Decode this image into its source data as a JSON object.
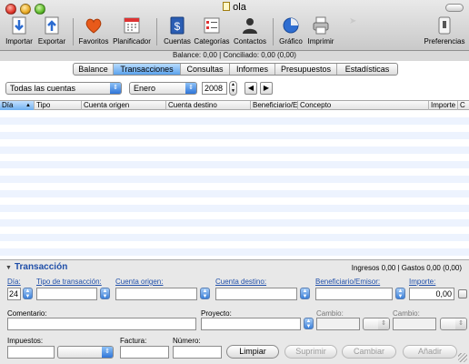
{
  "window": {
    "title": "ola"
  },
  "toolbar": {
    "items": [
      {
        "label": "Importar",
        "icon": "import-icon"
      },
      {
        "label": "Exportar",
        "icon": "export-icon"
      },
      {
        "label": "Favoritos",
        "icon": "heart-icon"
      },
      {
        "label": "Planificador",
        "icon": "calendar-icon"
      },
      {
        "label": "Cuentas",
        "icon": "dollar-ledger-icon"
      },
      {
        "label": "Categorías",
        "icon": "categories-icon"
      },
      {
        "label": "Contactos",
        "icon": "person-icon"
      },
      {
        "label": "Gráfico",
        "icon": "pie-chart-icon"
      },
      {
        "label": "Imprimir",
        "icon": "printer-icon"
      },
      {
        "label": "Preferencias",
        "icon": "preferences-switch-icon"
      }
    ]
  },
  "status": {
    "balance": "Balance: 0,00 | Conciliado: 0,00 (0,00)"
  },
  "tabs": [
    {
      "label": "Balance",
      "active": false
    },
    {
      "label": "Transacciones",
      "active": true
    },
    {
      "label": "Consultas",
      "active": false
    },
    {
      "label": "Informes",
      "active": false
    },
    {
      "label": "Presupuestos",
      "active": false
    },
    {
      "label": "Estadísticas",
      "active": false
    }
  ],
  "filters": {
    "account": "Todas las cuentas",
    "month": "Enero",
    "year": "2008",
    "prev": "◀",
    "next": "▶"
  },
  "table": {
    "columns": [
      "Día",
      "Tipo",
      "Cuenta origen",
      "Cuenta destino",
      "Beneficiario/E...",
      "Concepto",
      "Importe",
      "C"
    ],
    "sorted_column": "Día",
    "rows": []
  },
  "transaction": {
    "title": "Transacción",
    "summary": "Ingresos 0,00 | Gastos 0,00 (0,00)",
    "day_label": "Día:",
    "day_value": "24",
    "type_label": "Tipo de transacción:",
    "origin_label": "Cuenta origen:",
    "dest_label": "Cuenta destino:",
    "payee_label": "Beneficiario/Emisor:",
    "amount_label": "Importe:",
    "amount_value": "0,00",
    "comment_label": "Comentario:",
    "project_label": "Proyecto:",
    "exchange1_label": "Cambio:",
    "exchange2_label": "Cambio:",
    "taxes_label": "Impuestos:",
    "invoice_label": "Factura:",
    "number_label": "Número:",
    "buttons": {
      "clear": "Limpiar",
      "delete": "Suprimir",
      "change": "Cambiar",
      "add": "Añadir"
    }
  },
  "colors": {
    "accent": "#3b7fd8",
    "title_blue": "#1f4ea8",
    "row_stripe": "#edf3fe"
  }
}
